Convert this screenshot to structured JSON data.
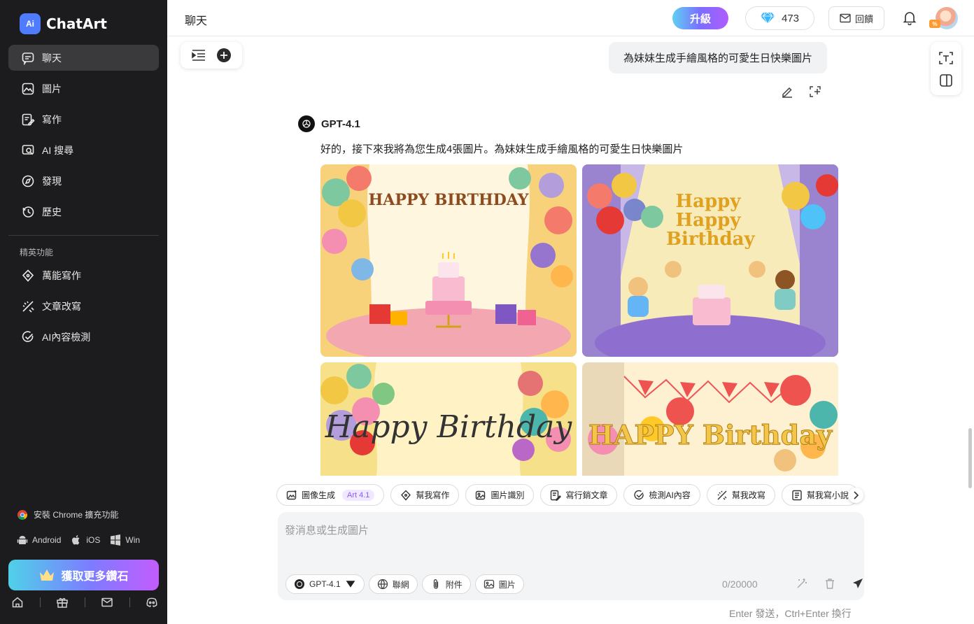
{
  "app": {
    "name": "ChatArt",
    "logo_badge": "Ai"
  },
  "sidebar": {
    "items": [
      {
        "label": "聊天",
        "icon": "chat-icon"
      },
      {
        "label": "圖片",
        "icon": "image-icon"
      },
      {
        "label": "寫作",
        "icon": "write-icon"
      },
      {
        "label": "AI 搜尋",
        "icon": "ai-search-icon"
      },
      {
        "label": "發現",
        "icon": "compass-icon"
      },
      {
        "label": "歷史",
        "icon": "history-icon"
      }
    ],
    "section_label": "精英功能",
    "elite_items": [
      {
        "label": "萬能寫作",
        "icon": "diamond-pen-icon"
      },
      {
        "label": "文章改寫",
        "icon": "rewrite-icon"
      },
      {
        "label": "AI內容檢測",
        "icon": "check-circle-icon"
      }
    ],
    "chrome_ext": "安裝 Chrome 擴充功能",
    "platforms": [
      "Android",
      "iOS",
      "Win"
    ],
    "cta": "獲取更多鑽石"
  },
  "header": {
    "title": "聊天",
    "upgrade": "升級",
    "gems": "473",
    "feedback": "回饋",
    "avatar_badge": "%"
  },
  "chat": {
    "user_message": "為妹妹生成手繪風格的可愛生日快樂圖片",
    "bot_name": "GPT-4.1",
    "bot_text": "好的，接下來我將為您生成4張圖片。為妹妹生成手繪風格的可愛生日快樂圖片",
    "images": [
      {
        "caption": "HAPPY BIRTHDAY"
      },
      {
        "caption": "Happy Happy Birthday"
      },
      {
        "caption": "Happy Birthday"
      },
      {
        "caption": "HAPPY Birthday"
      }
    ]
  },
  "tools": [
    {
      "label": "圖像生成",
      "badge": "Art 4.1",
      "icon": "image-gen-icon"
    },
    {
      "label": "幫我寫作",
      "icon": "diamond-pen-icon"
    },
    {
      "label": "圖片識別",
      "icon": "image-scan-icon"
    },
    {
      "label": "寫行銷文章",
      "icon": "article-icon"
    },
    {
      "label": "檢測AI內容",
      "icon": "check-circle-icon"
    },
    {
      "label": "幫我改寫",
      "icon": "rewrite-icon"
    },
    {
      "label": "幫我寫小說",
      "icon": "book-icon"
    }
  ],
  "composer": {
    "placeholder": "發消息或生成圖片",
    "model": "GPT-4.1",
    "web": "聯網",
    "attach": "附件",
    "image": "圖片",
    "counter": "0/20000",
    "hint": "Enter 發送，Ctrl+Enter 換行"
  },
  "colors": {
    "sidebar_bg": "#1c1c1e",
    "accent": "#7b6cff",
    "cta_gradient": [
      "#4fd1e8",
      "#7d7cff",
      "#c45cff"
    ]
  }
}
